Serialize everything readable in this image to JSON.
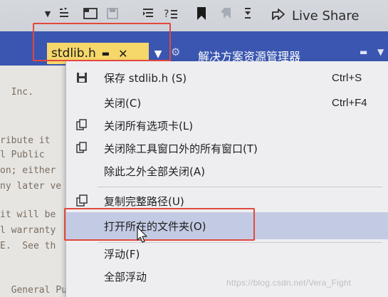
{
  "toolbar": {
    "live_share_label": "Live Share",
    "icons": [
      "dropdown-arrow-icon",
      "list-format-icon",
      "find-icon",
      "save-icon",
      "indent-icon",
      "format-icon",
      "bookmark-icon",
      "bookmark-nav-icon",
      "more-icon",
      "live-share-icon"
    ]
  },
  "tab": {
    "title": "stdlib.h",
    "pin_glyph": "▬",
    "close_glyph": "✕",
    "dropdown_glyph": "▼",
    "gear_glyph": "⚙"
  },
  "pane": {
    "title": "解决方案资源管理器",
    "pin_glyph": "▬",
    "caret_glyph": "▼"
  },
  "editor_lines": [
    "  Inc.",
    "",
    "",
    "ribute it",
    "l Public",
    "on; either",
    "ny later ve",
    "",
    "it will be",
    "l warranty",
    "E.  See th",
    "",
    "",
    "  General Pu"
  ],
  "menu": {
    "items": [
      {
        "label": "保存 stdlib.h (S)",
        "shortcut": "Ctrl+S",
        "icon": "save-icon"
      },
      {
        "label": "关闭(C)",
        "shortcut": "Ctrl+F4",
        "icon": ""
      },
      {
        "label": "关闭所有选项卡(L)",
        "shortcut": "",
        "icon": "close-all-tabs-icon"
      },
      {
        "label": "关闭除工具窗口外的所有窗口(T)",
        "shortcut": "",
        "icon": "close-windows-icon"
      },
      {
        "label": "除此之外全部关闭(A)",
        "shortcut": "",
        "icon": ""
      },
      {
        "label": "复制完整路径(U)",
        "shortcut": "",
        "icon": "copy-path-icon"
      },
      {
        "label": "打开所在的文件夹(O)",
        "shortcut": "",
        "icon": "",
        "active": true
      },
      {
        "label": "浮动(F)",
        "shortcut": "",
        "icon": ""
      },
      {
        "label": "全部浮动",
        "shortcut": "",
        "icon": ""
      }
    ]
  },
  "watermark": "https://blog.csdn.net/Vera_Fight",
  "colors": {
    "tab_strip": "#3a56b0",
    "active_tab": "#f5d76a",
    "menu_highlight": "#c3cbe4",
    "annotation_red": "#e2483c"
  }
}
